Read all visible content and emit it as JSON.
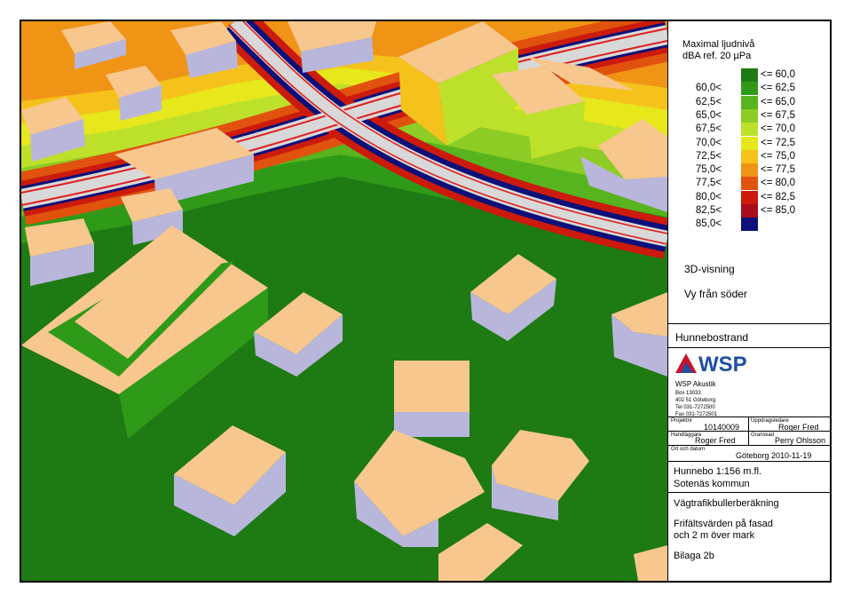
{
  "legend": {
    "title_line1": "Maximal ljudnivå",
    "title_line2": "dBA ref. 20 µPa",
    "rows": [
      {
        "lo": "",
        "hi": "<= 60,0",
        "color": "#1e7a12"
      },
      {
        "lo": "60,0<",
        "hi": "<= 62,5",
        "color": "#2f9a18"
      },
      {
        "lo": "62,5<",
        "hi": "<= 65,0",
        "color": "#58b41e"
      },
      {
        "lo": "65,0<",
        "hi": "<= 67,5",
        "color": "#8ccc24"
      },
      {
        "lo": "67,5<",
        "hi": "<= 70,0",
        "color": "#bde02a"
      },
      {
        "lo": "70,0<",
        "hi": "<= 72,5",
        "color": "#e6e81c"
      },
      {
        "lo": "72,5<",
        "hi": "<= 75,0",
        "color": "#f4c21a"
      },
      {
        "lo": "75,0<",
        "hi": "<= 77,5",
        "color": "#f09416"
      },
      {
        "lo": "77,5<",
        "hi": "<= 80,0",
        "color": "#e0520e"
      },
      {
        "lo": "80,0<",
        "hi": "<= 82,5",
        "color": "#cc1a0c"
      },
      {
        "lo": "82,5<",
        "hi": "<= 85,0",
        "color": "#a80c1c"
      },
      {
        "lo": "85,0<",
        "hi": "",
        "color": "#0c1078"
      }
    ]
  },
  "view": {
    "line1": "3D-visning",
    "line2": "Vy från söder"
  },
  "place": "Hunnebostrand",
  "company": {
    "logo_text": "WSP",
    "name": "WSP Akustik",
    "address": [
      "Box 13033",
      "402 51 Göteborg",
      "Tel 031-7272500",
      "Fax 031-7272501"
    ]
  },
  "fields": {
    "projnr_label": "Projektnr",
    "projnr": "10140009",
    "uppdragsledare_label": "Uppdragsledare",
    "uppdragsledare": "Roger Fred",
    "handlaggare_label": "Handläggare",
    "handlaggare": "Roger Fred",
    "granskad_label": "Granskad",
    "granskad": "Perry Ohlsson",
    "ort_label": "Ort och datum",
    "ort_datum": "Göteborg 2010-11-19"
  },
  "info": {
    "scale": "Hunnebo 1:156 m.fl.",
    "kommun": "Sotenäs kommun",
    "type": "Vägtrafikbullerberäkning",
    "desc1": "Frifältsvärden på fasad",
    "desc2": "och 2 m över mark",
    "bilaga": "Bilaga 2b"
  },
  "colors": {
    "roof": "#f7c78e",
    "wall": "#b9b6dc",
    "road": "#d8d8d8",
    "road_line": "#e02020",
    "ground_low": "#1e7a12"
  }
}
